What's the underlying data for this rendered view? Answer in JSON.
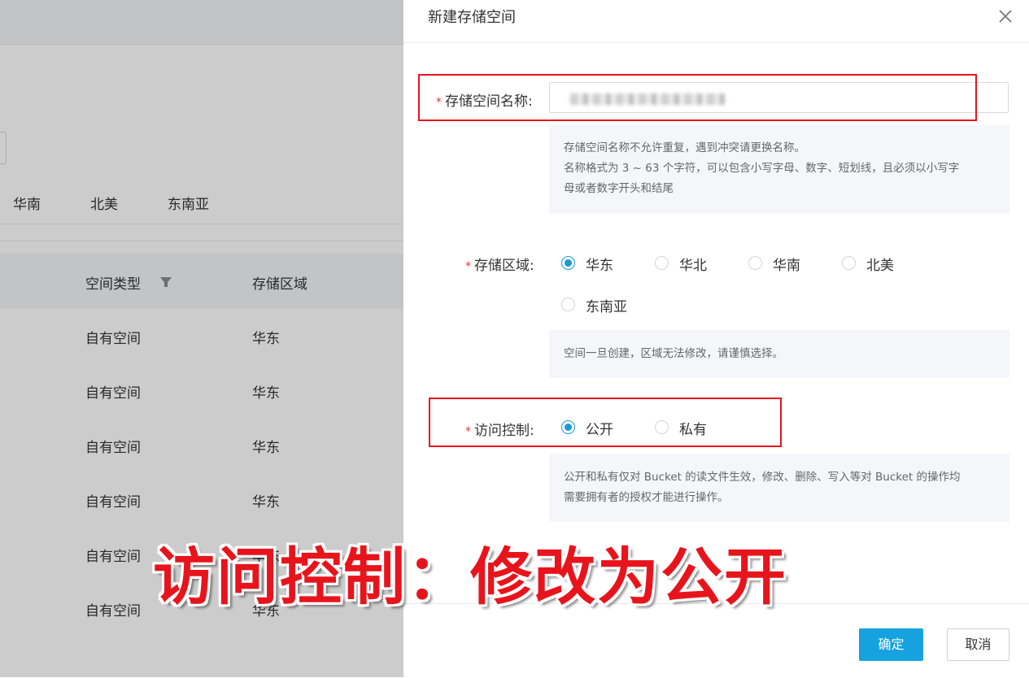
{
  "background": {
    "region_tabs": [
      "华南",
      "北美",
      "东南亚"
    ],
    "table": {
      "headers": [
        "空间类型",
        "存储区域"
      ],
      "rows": [
        [
          "自有空间",
          "华东"
        ],
        [
          "自有空间",
          "华东"
        ],
        [
          "自有空间",
          "华东"
        ],
        [
          "自有空间",
          "华东"
        ],
        [
          "自有空间",
          "华东"
        ],
        [
          "自有空间",
          "华东"
        ]
      ]
    }
  },
  "drawer": {
    "title": "新建存储空间",
    "name_field": {
      "label": "存储空间名称:",
      "hint_line1": "存储空间名称不允许重复，遇到冲突请更换名称。",
      "hint_line2": "名称格式为 3 ~ 63 个字符，可以包含小写字母、数字、短划线，且必须以小写字",
      "hint_line3": "母或者数字开头和结尾"
    },
    "region_field": {
      "label": "存储区域:",
      "options": [
        "华东",
        "华北",
        "华南",
        "北美",
        "东南亚"
      ],
      "selected": "华东",
      "hint": "空间一旦创建，区域无法修改，请谨慎选择。"
    },
    "access_field": {
      "label": "访问控制:",
      "options": [
        "公开",
        "私有"
      ],
      "selected": "公开",
      "hint_line1": "公开和私有仅对 Bucket 的读文件生效，修改、删除、写入等对 Bucket 的操作均",
      "hint_line2": "需要拥有者的授权才能进行操作。"
    },
    "buttons": {
      "confirm": "确定",
      "cancel": "取消"
    }
  },
  "caption": "访问控制：修改为公开",
  "colors": {
    "accent": "#16a2df",
    "required": "#e8323c",
    "annotation_red": "#e8141c"
  },
  "icons": {
    "close": "close-icon",
    "filter": "filter-icon"
  }
}
